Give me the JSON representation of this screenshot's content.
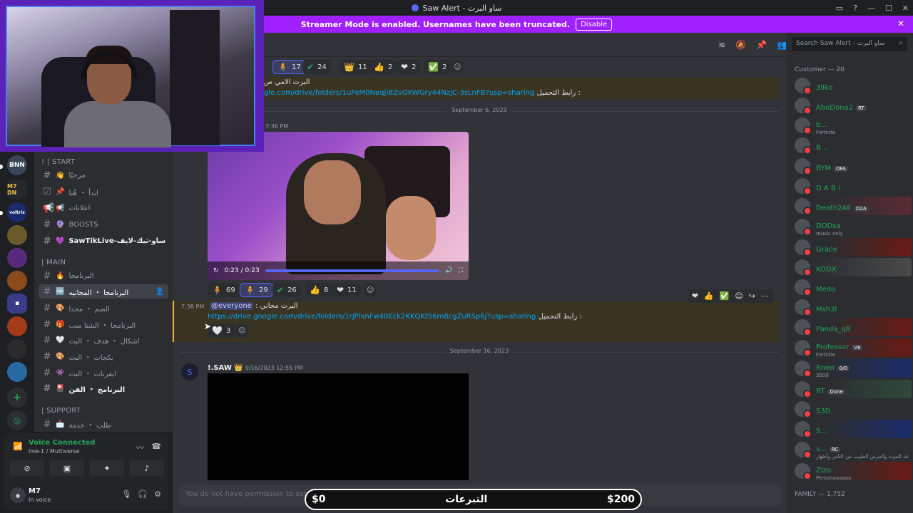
{
  "window": {
    "title": "Saw Alert - ساو البرت"
  },
  "banner": {
    "text": "Streamer Mode is enabled. Usernames have been truncated.",
    "disable": "Disable"
  },
  "header": {
    "search_placeholder": "Search Saw Alert - ساو البرت"
  },
  "servers": [
    "BNN",
    "M7 DN",
    "voltrix"
  ],
  "channels": {
    "start_cat": "! | START",
    "main_cat": "| MAIN",
    "support_cat": "| SUPPORT",
    "items": [
      {
        "label": "مرحبًا",
        "emo": "👋"
      },
      {
        "label": "ابدأ ・ هُنا",
        "emo": "📌"
      },
      {
        "label": "اعلانات",
        "emo": "📢"
      },
      {
        "label": "BOOSTS",
        "emo": "🔮"
      },
      {
        "label": "SawTikLive-ساو-تيك-لايف",
        "emo": "💜"
      },
      {
        "label": "البرنامجا",
        "emo": "🔥"
      },
      {
        "label": "البرنامجا ・ المجانيه",
        "emo": "🆓"
      },
      {
        "label": "الضم ・ محدا",
        "emo": "🎨"
      },
      {
        "label": "البرنامجا ・ الشتا سب",
        "emo": "🎁"
      },
      {
        "label": "اشكال ・ هدف ・ البث",
        "emo": "🤍"
      },
      {
        "label": "بكجات ・ البث",
        "emo": "🎨"
      },
      {
        "label": "ايفرنات ・ البث",
        "emo": "👾"
      },
      {
        "label": "البرنامج ・ الفن",
        "emo": "🎴"
      },
      {
        "label": "طلب ・ خدمة",
        "emo": "📩"
      }
    ]
  },
  "voice": {
    "status": "Voice Connected",
    "channel": "live-1 / Multiverse"
  },
  "user": {
    "name": "M7",
    "status": "In voice"
  },
  "messages": {
    "top_reactions": [
      "17",
      "24",
      "11",
      "2",
      "2",
      "2"
    ],
    "top_text": "البرت الامي ص",
    "top_link": "gle.com/drive/folders/1uFeM0NeqJiBZvOKWGry44NzjC-3sLnFB?usp=sharing",
    "top_label": "رابط التحميل :",
    "date1": "September 6, 2023",
    "time1": "7:36 PM",
    "video_time": "0:23 / 0:23",
    "vid_reactions": [
      "69",
      "29",
      "26",
      "8",
      "11"
    ],
    "time2": "7:38 PM",
    "msg2_mention": "@everyone",
    "msg2_text": ": البرت مجاني",
    "msg2_link": "https://drive.google.com/drive/folders/1rjPlxnFw40Eck2KKQKt56m8cgZuRSp6j?usp=sharing",
    "msg2_label": "رابط التحميل :",
    "msg2_react": "3",
    "date2": "September 16, 2023",
    "author3": "!.SAW",
    "time3": "9/16/2023 12:55 PM",
    "input_placeholder": "You do not have permission to send messages in this channel."
  },
  "donation": {
    "left": "$0",
    "title": "التبرعات",
    "right": "$200"
  },
  "members": {
    "cat1": "Customer — 20",
    "cat2": "FAMILY — 1,752",
    "list": [
      {
        "name": "3liko",
        "sub": "",
        "tag": ""
      },
      {
        "name": "AboDona2",
        "sub": "",
        "tag": "RT"
      },
      {
        "name": "b...",
        "sub": "Fortnite",
        "tag": ""
      },
      {
        "name": "B...",
        "sub": "",
        "tag": ""
      },
      {
        "name": "BYM",
        "sub": "",
        "tag": "OFA"
      },
      {
        "name": "D A B i",
        "sub": "",
        "tag": ""
      },
      {
        "name": "Death2All",
        "sub": "",
        "tag": "D2A"
      },
      {
        "name": "DODsa",
        "sub": "music only",
        "tag": ""
      },
      {
        "name": "Grace",
        "sub": "",
        "tag": ""
      },
      {
        "name": "KODX",
        "sub": "",
        "tag": ""
      },
      {
        "name": "Medo",
        "sub": "",
        "tag": ""
      },
      {
        "name": "Msh3l",
        "sub": "",
        "tag": ""
      },
      {
        "name": "Panda_q8",
        "sub": "",
        "tag": ""
      },
      {
        "name": "Professor",
        "sub": "Fortnite",
        "tag": "V8"
      },
      {
        "name": "Rnen",
        "sub": "3500",
        "tag": "0/0"
      },
      {
        "name": "RT",
        "sub": "",
        "tag": "Done"
      },
      {
        "name": "S3D",
        "sub": "",
        "tag": ""
      },
      {
        "name": "S...",
        "sub": "",
        "tag": ""
      },
      {
        "name": "v...",
        "sub": "من علاقة الموت والمرض الطبيب من الناس وأطهار",
        "tag": "RC"
      },
      {
        "name": "Zizo",
        "sub": "Personaaaaaa",
        "tag": ""
      }
    ]
  }
}
